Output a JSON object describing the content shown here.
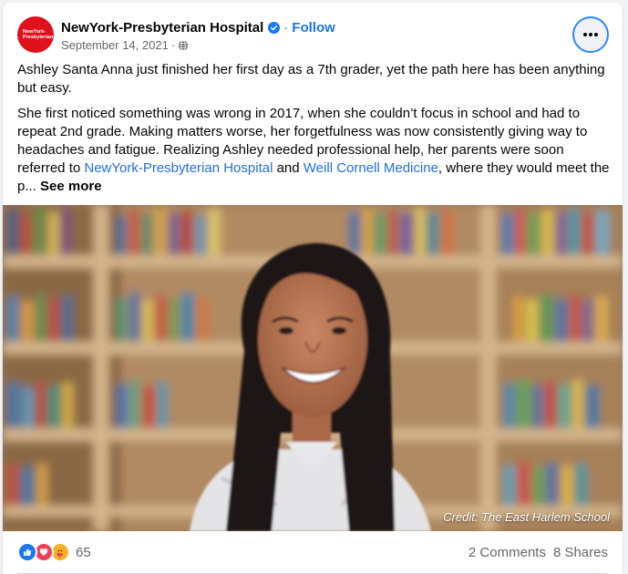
{
  "post": {
    "page_name": "NewYork-Presbyterian Hospital",
    "avatar_text": "NewYork-\nPresbyterian",
    "follow_label": "Follow",
    "date": "September 14, 2021",
    "meta_separator": "·",
    "paragraph1": "Ashley Santa Anna just finished her first day as a 7th grader, yet the path here has been anything but easy.",
    "paragraph2_part1": "She first noticed something was wrong in 2017, when she couldn’t focus in school and had to repeat 2nd grade. Making matters worse, her forgetfulness was now consistently giving way to headaches and fatigue. Realizing Ashley needed professional help, her parents were soon referred to ",
    "link1": "NewYork-Presbyterian Hospital",
    "paragraph2_part2": " and ",
    "link2": "Weill Cornell Medicine",
    "paragraph2_part3": ", where they would meet the p... ",
    "see_more": "See more",
    "photo_credit": "Credit: The East Harlem School"
  },
  "footer": {
    "reaction_count": "65",
    "comments": "2 Comments",
    "shares": "8 Shares"
  },
  "icons": {
    "verified": "verified-badge-icon",
    "globe": "globe-icon",
    "more": "more-options-icon",
    "reactions": [
      "like-reaction-icon",
      "love-reaction-icon",
      "care-reaction-icon"
    ]
  },
  "colors": {
    "brand_red": "#e0101c",
    "link_blue": "#216fdb",
    "follow_blue": "#1b74e4",
    "like_blue": "#1877f2",
    "love_red": "#f33e58",
    "care_yellow": "#f7b125"
  }
}
